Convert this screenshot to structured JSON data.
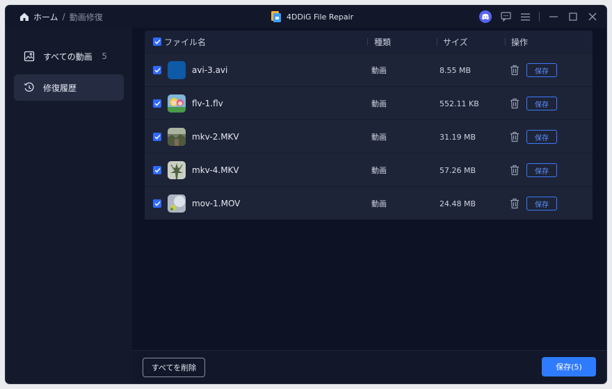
{
  "titlebar": {
    "breadcrumb_home": "ホーム",
    "breadcrumb_sep": "/",
    "breadcrumb_current": "動画修復",
    "app_title": "4DDiG File Repair"
  },
  "sidebar": {
    "items": [
      {
        "label": "すべての動画",
        "count": "5",
        "icon": "image-icon",
        "active": false
      },
      {
        "label": "修復履歴",
        "icon": "history-icon",
        "active": true
      }
    ]
  },
  "table": {
    "headers": {
      "name": "ファイル名",
      "type": "種類",
      "size": "サイズ",
      "action": "操作"
    },
    "rows": [
      {
        "name": "avi-3.avi",
        "type": "動画",
        "size": "8.55 MB",
        "save": "保存",
        "thumb": "blue"
      },
      {
        "name": "flv-1.flv",
        "type": "動画",
        "size": "552.11 KB",
        "save": "保存",
        "thumb": "anime"
      },
      {
        "name": "mkv-2.MKV",
        "type": "動画",
        "size": "31.19 MB",
        "save": "保存",
        "thumb": "nature"
      },
      {
        "name": "mkv-4.MKV",
        "type": "動画",
        "size": "57.26 MB",
        "save": "保存",
        "thumb": "tree"
      },
      {
        "name": "mov-1.MOV",
        "type": "動画",
        "size": "24.48 MB",
        "save": "保存",
        "thumb": "grey"
      }
    ]
  },
  "footer": {
    "delete_all": "すべてを削除",
    "save_all": "保存(5)"
  },
  "colors": {
    "accent": "#2f7bff",
    "background": "#0d1225",
    "row": "#1e2437"
  }
}
